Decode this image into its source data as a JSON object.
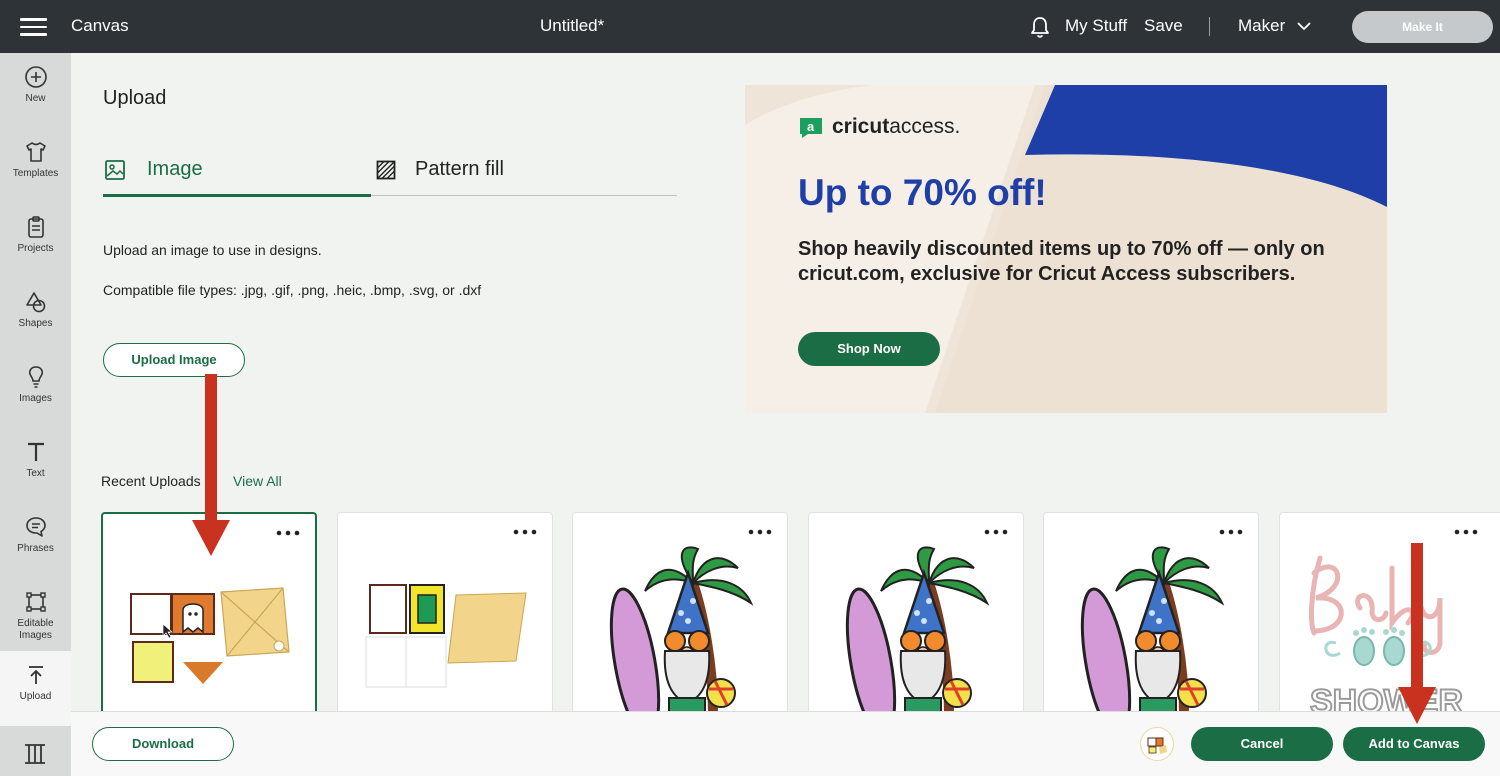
{
  "header": {
    "app_title": "Canvas",
    "doc_title": "Untitled*",
    "my_stuff": "My Stuff",
    "save": "Save",
    "machine": "Maker",
    "make_it": "Make It"
  },
  "sidebar": {
    "items": [
      {
        "label": "New",
        "icon": "plus-circle-icon"
      },
      {
        "label": "Templates",
        "icon": "shirt-icon"
      },
      {
        "label": "Projects",
        "icon": "clipboard-icon"
      },
      {
        "label": "Shapes",
        "icon": "shapes-icon"
      },
      {
        "label": "Images",
        "icon": "lightbulb-icon"
      },
      {
        "label": "Text",
        "icon": "text-icon"
      },
      {
        "label": "Phrases",
        "icon": "speech-bubble-icon"
      },
      {
        "label": "Editable Images",
        "icon": "editable-images-icon"
      },
      {
        "label": "Upload",
        "icon": "upload-icon"
      }
    ]
  },
  "upload": {
    "heading": "Upload",
    "tabs": [
      {
        "label": "Image",
        "icon": "image-icon",
        "active": true
      },
      {
        "label": "Pattern fill",
        "icon": "pattern-icon",
        "active": false
      }
    ],
    "description": "Upload an image to use in designs.",
    "file_types": "Compatible file types: .jpg, .gif, .png, .heic, .bmp, .svg, or .dxf",
    "upload_button": "Upload Image"
  },
  "ad": {
    "logo_brand": "cricut",
    "logo_suffix": "access.",
    "headline": "Up to 70% off!",
    "body": "Shop heavily discounted items up to 70% off — only on cricut.com, exclusive for Cricut Access subscribers.",
    "button": "Shop Now",
    "colors": {
      "headline": "#1f3fa8",
      "accent_blue": "#1f3fa8",
      "button": "#1b6d45"
    }
  },
  "recent": {
    "label": "Recent Uploads",
    "view_all": "View All",
    "cards": [
      {
        "content": "envelope-ghost-design",
        "selected": true
      },
      {
        "content": "envelope-design",
        "selected": false
      },
      {
        "content": "gnome-surfboard-palm",
        "selected": false
      },
      {
        "content": "gnome-surfboard-palm",
        "selected": false
      },
      {
        "content": "gnome-surfboard-palm",
        "selected": false
      },
      {
        "content": "baby-shower-text",
        "selected": false
      }
    ]
  },
  "footer": {
    "download": "Download",
    "cancel": "Cancel",
    "add_to_canvas": "Add to Canvas"
  },
  "colors": {
    "topbar": "#2e3338",
    "brand_green": "#1b6d45",
    "annotation_arrow": "#c8321f"
  }
}
